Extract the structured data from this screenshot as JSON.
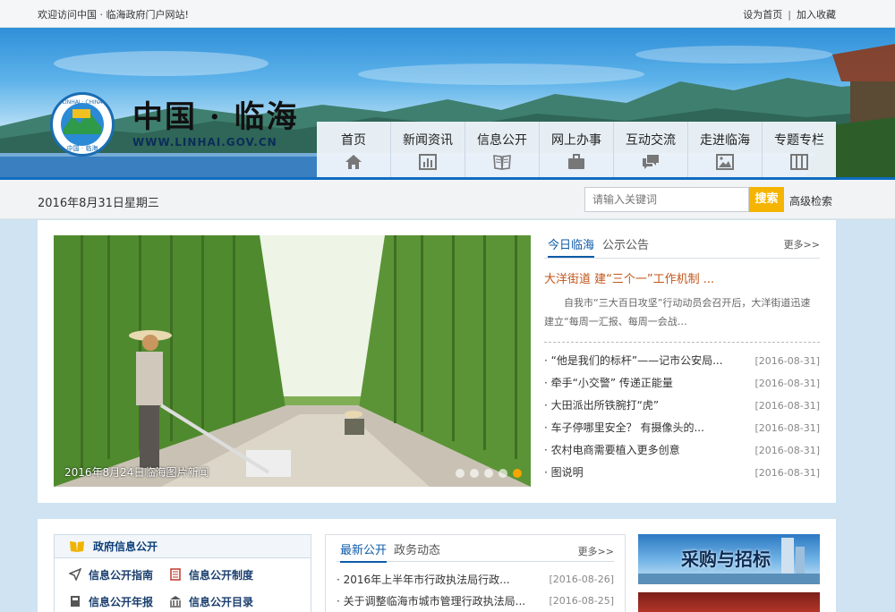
{
  "topbar": {
    "welcome": "欢迎访问中国 · 临海政府门户网站!",
    "set_home": "设为首页",
    "separator": "|",
    "add_favorite": "加入收藏"
  },
  "header": {
    "logo_title": "中国 · 临海",
    "logo_url": "WWW.LINHAI.GOV.CN",
    "logo_ring_top": "LINHAI · CHINA",
    "logo_ring_bottom": "中国 · 临海"
  },
  "nav": {
    "items": [
      {
        "label": "首页",
        "icon": "home-icon"
      },
      {
        "label": "新闻资讯",
        "icon": "chart-icon"
      },
      {
        "label": "信息公开",
        "icon": "book-icon"
      },
      {
        "label": "网上办事",
        "icon": "briefcase-icon"
      },
      {
        "label": "互动交流",
        "icon": "chat-icon"
      },
      {
        "label": "走进临海",
        "icon": "picture-icon"
      },
      {
        "label": "专题专栏",
        "icon": "columns-icon"
      }
    ]
  },
  "datebar": {
    "date": "2016年8月31日星期三",
    "search_placeholder": "请输入关键词",
    "search_button": "搜索",
    "advanced": "高级检索"
  },
  "slideshow": {
    "caption": "2016年8月24日临海图片新闻",
    "dot_count": 5,
    "active_dot": 5
  },
  "today_news": {
    "tabs": [
      "今日临海",
      "公示公告"
    ],
    "more": "更多>>",
    "headline": "大洋街道 建“三个一”工作机制 ...",
    "summary": "自我市“三大百日攻坚”行动动员会召开后，大洋街道迅速建立“每周一汇报、每周一会战…",
    "items": [
      {
        "title": "“他是我们的标杆”——记市公安局...",
        "date": "[2016-08-31]"
      },
      {
        "title": "牵手“小交警” 传递正能量",
        "date": "[2016-08-31]"
      },
      {
        "title": "大田派出所铁腕打“虎”",
        "date": "[2016-08-31]"
      },
      {
        "title": "车子停哪里安全？ 有摄像头的...",
        "date": "[2016-08-31]"
      },
      {
        "title": "农村电商需要植入更多创意",
        "date": "[2016-08-31]"
      },
      {
        "title": "图说明",
        "date": "[2016-08-31]"
      }
    ]
  },
  "gov_info": {
    "title": "政府信息公开",
    "links": [
      "信息公开指南",
      "信息公开制度",
      "信息公开年报",
      "信息公开目录"
    ]
  },
  "latest_public": {
    "tabs": [
      "最新公开",
      "政务动态"
    ],
    "more": "更多>>",
    "items": [
      {
        "title": "2016年上半年市行政执法局行政...",
        "date": "[2016-08-26]"
      },
      {
        "title": "关于调整临海市城市管理行政执法局...",
        "date": "[2016-08-25]"
      }
    ]
  },
  "side_banners": {
    "procurement": "采购与招标"
  },
  "colors": {
    "nav_line": "#0e6cc0",
    "search_button": "#f5b400",
    "headline": "#c0561a",
    "tab_active": "#0e5ba8",
    "dot_active": "#f5a500"
  }
}
